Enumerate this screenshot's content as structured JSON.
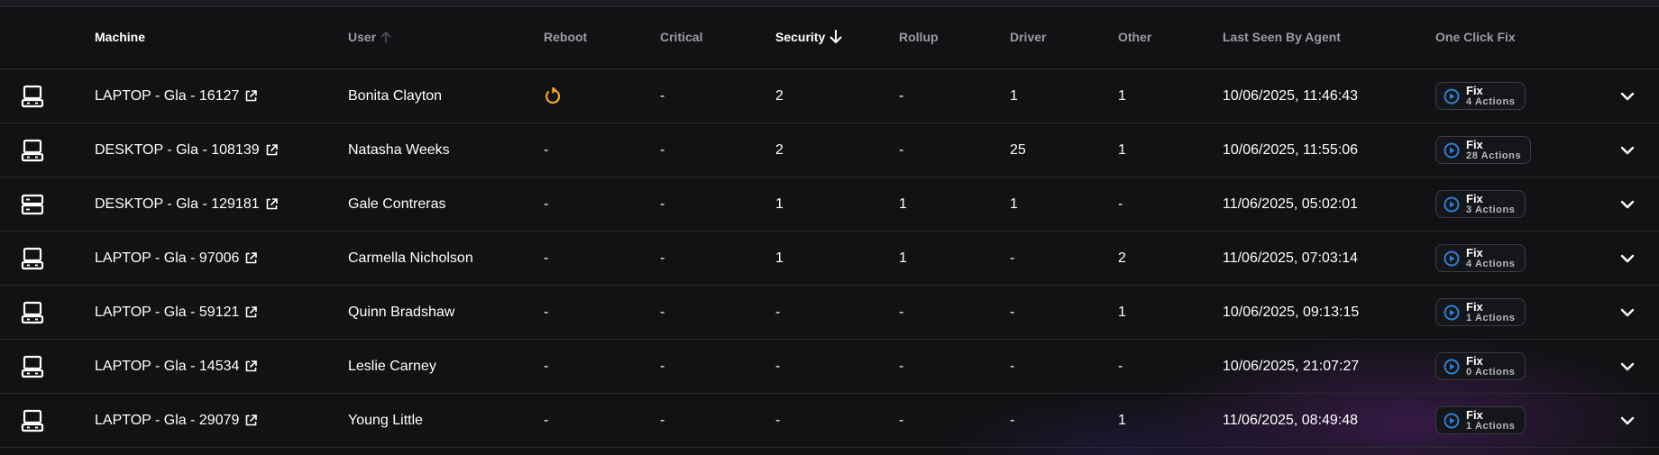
{
  "header": {
    "machine": "Machine",
    "user": "User",
    "reboot": "Reboot",
    "critical": "Critical",
    "security": "Security",
    "rollup": "Rollup",
    "driver": "Driver",
    "other": "Other",
    "last_seen": "Last Seen By Agent",
    "one_click_fix": "One Click Fix",
    "sort_active_column": "Security",
    "sort_direction": "descending"
  },
  "fix_label": "Fix",
  "colors": {
    "background": "#111214",
    "reboot_icon": "#f5a623",
    "fix_icon": "#2f7fd1",
    "text": "#ffffff",
    "header_text": "#9a9ca3"
  },
  "rows": [
    {
      "device_icon": "laptop-icon",
      "machine": "LAPTOP - Gla - 16127",
      "user": "Bonita Clayton",
      "reboot": "reboot-icon",
      "critical": "-",
      "security": "2",
      "rollup": "-",
      "driver": "1",
      "other": "1",
      "last_seen": "10/06/2025, 11:46:43",
      "actions": "4 Actions"
    },
    {
      "device_icon": "laptop-icon",
      "machine": "DESKTOP - Gla - 108139",
      "user": "Natasha Weeks",
      "reboot": "-",
      "critical": "-",
      "security": "2",
      "rollup": "-",
      "driver": "25",
      "other": "1",
      "last_seen": "10/06/2025, 11:55:06",
      "actions": "28 Actions"
    },
    {
      "device_icon": "server-icon",
      "machine": "DESKTOP - Gla - 129181",
      "user": "Gale Contreras",
      "reboot": "-",
      "critical": "-",
      "security": "1",
      "rollup": "1",
      "driver": "1",
      "other": "-",
      "last_seen": "11/06/2025, 05:02:01",
      "actions": "3 Actions"
    },
    {
      "device_icon": "laptop-icon",
      "machine": "LAPTOP - Gla - 97006",
      "user": "Carmella Nicholson",
      "reboot": "-",
      "critical": "-",
      "security": "1",
      "rollup": "1",
      "driver": "-",
      "other": "2",
      "last_seen": "11/06/2025, 07:03:14",
      "actions": "4 Actions"
    },
    {
      "device_icon": "laptop-icon",
      "machine": "LAPTOP - Gla - 59121",
      "user": "Quinn Bradshaw",
      "reboot": "-",
      "critical": "-",
      "security": "-",
      "rollup": "-",
      "driver": "-",
      "other": "1",
      "last_seen": "10/06/2025, 09:13:15",
      "actions": "1 Actions"
    },
    {
      "device_icon": "laptop-icon",
      "machine": "LAPTOP - Gla - 14534",
      "user": "Leslie Carney",
      "reboot": "-",
      "critical": "-",
      "security": "-",
      "rollup": "-",
      "driver": "-",
      "other": "-",
      "last_seen": "10/06/2025, 21:07:27",
      "actions": "0 Actions"
    },
    {
      "device_icon": "laptop-icon",
      "machine": "LAPTOP - Gla - 29079",
      "user": "Young Little",
      "reboot": "-",
      "critical": "-",
      "security": "-",
      "rollup": "-",
      "driver": "-",
      "other": "1",
      "last_seen": "11/06/2025, 08:49:48",
      "actions": "1 Actions"
    }
  ]
}
